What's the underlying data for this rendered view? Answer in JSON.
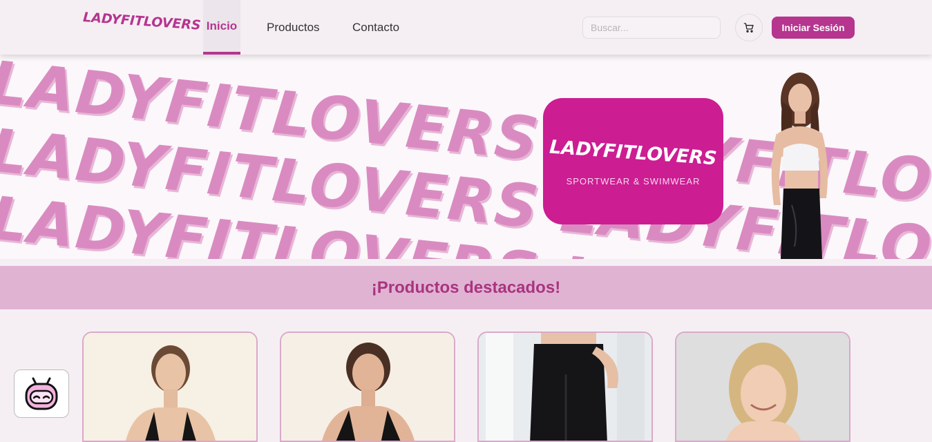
{
  "header": {
    "logo": "LADYFITLOVERS",
    "nav": [
      {
        "label": "Inicio",
        "active": true
      },
      {
        "label": "Productos",
        "active": false
      },
      {
        "label": "Contacto",
        "active": false
      }
    ],
    "search_placeholder": "Buscar...",
    "cart_icon": "cart-icon",
    "login_label": "Iniciar Sesión"
  },
  "banner": {
    "pattern_text": "LADYFITLOVERS",
    "brand_title": "LADYFITLOVERS",
    "brand_subtitle": "SPORTWEAR & SWIMWEAR"
  },
  "featured": {
    "title": "¡Productos destacados!"
  },
  "products": [
    {
      "image": "model-sports-top"
    },
    {
      "image": "model-sports-top"
    },
    {
      "image": "model-black-leggings"
    },
    {
      "image": "model-portrait"
    }
  ],
  "chatbot": {
    "icon": "robot-icon"
  },
  "colors": {
    "accent": "#b5358f",
    "brand_box": "#cc1d93",
    "featured_bar": "#e0b3d3",
    "pattern": "#d98bc1",
    "background": "#f5eff4"
  }
}
